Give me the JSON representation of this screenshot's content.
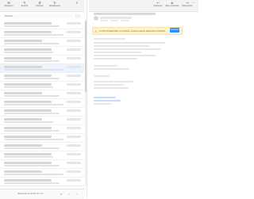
{
  "left_toolbar": {
    "buttons": [
      {
        "label": "Markieren",
        "icon": "mail-icon"
      },
      {
        "label": "Entwurf",
        "icon": "edit-icon"
      },
      {
        "label": "Optionen",
        "icon": "gear-icon"
      },
      {
        "label": "Aktualisieren",
        "icon": "refresh-icon"
      }
    ],
    "collapse_icon": "≡"
  },
  "right_toolbar": {
    "buttons": [
      {
        "label": "Antworten",
        "icon": "reply-icon"
      },
      {
        "label": "Allen antworten",
        "icon": "reply-all-icon"
      },
      {
        "label": "Weiterleiten",
        "icon": "forward-icon"
      }
    ],
    "more_icon": "⋯"
  },
  "search": {
    "placeholder": "Suchen..."
  },
  "warning": {
    "text": "Um Ihre Privatsphäre zu schützen, wurden externe Ressourcen blockiert.",
    "button": "Anzeigen"
  },
  "pager": {
    "text": "Nachrichten 1 bis 50 von 177",
    "first": "«",
    "prev": "‹",
    "next": "›"
  },
  "colors": {
    "accent": "#2d8cff",
    "warning_bg": "#fff3cd",
    "selected_bg": "#e9f4ff"
  }
}
